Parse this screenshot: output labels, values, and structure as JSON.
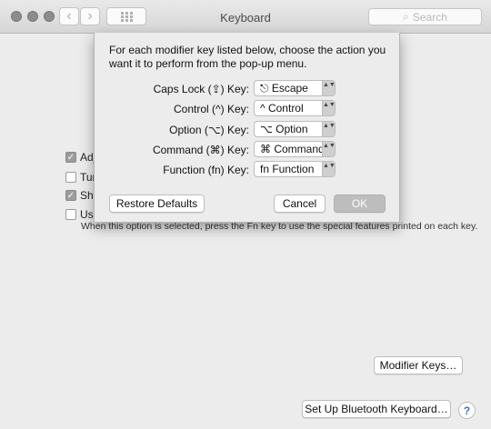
{
  "window": {
    "title": "Keyboard"
  },
  "toolbar": {
    "back_glyph": "‹",
    "forward_glyph": "›",
    "search_placeholder": "Search",
    "search_icon_glyph": "⌕"
  },
  "background": {
    "checkboxes": [
      {
        "label": "Adj",
        "checked": true
      },
      {
        "label": "Tur",
        "checked": false
      },
      {
        "label": "Sho",
        "checked": true
      },
      {
        "label": "Use",
        "checked": false
      }
    ],
    "note": "When this option is selected, press the Fn key to use the special features printed on each key.",
    "modifier_keys_button": "Modifier Keys…",
    "bluetooth_button": "Set Up Bluetooth Keyboard…",
    "help_glyph": "?"
  },
  "sheet": {
    "intro": "For each modifier key listed below, choose the action you want it to perform from the pop-up menu.",
    "rows": [
      {
        "label": "Caps Lock (⇪) Key:",
        "value": "⎋ Escape"
      },
      {
        "label": "Control (^) Key:",
        "value": "^ Control"
      },
      {
        "label": "Option (⌥) Key:",
        "value": "⌥ Option"
      },
      {
        "label": "Command (⌘) Key:",
        "value": "⌘ Command"
      },
      {
        "label": "Function (fn) Key:",
        "value": "fn Function"
      }
    ],
    "restore_defaults": "Restore Defaults",
    "cancel": "Cancel",
    "ok": "OK",
    "popup_arrows": "▲▼"
  }
}
